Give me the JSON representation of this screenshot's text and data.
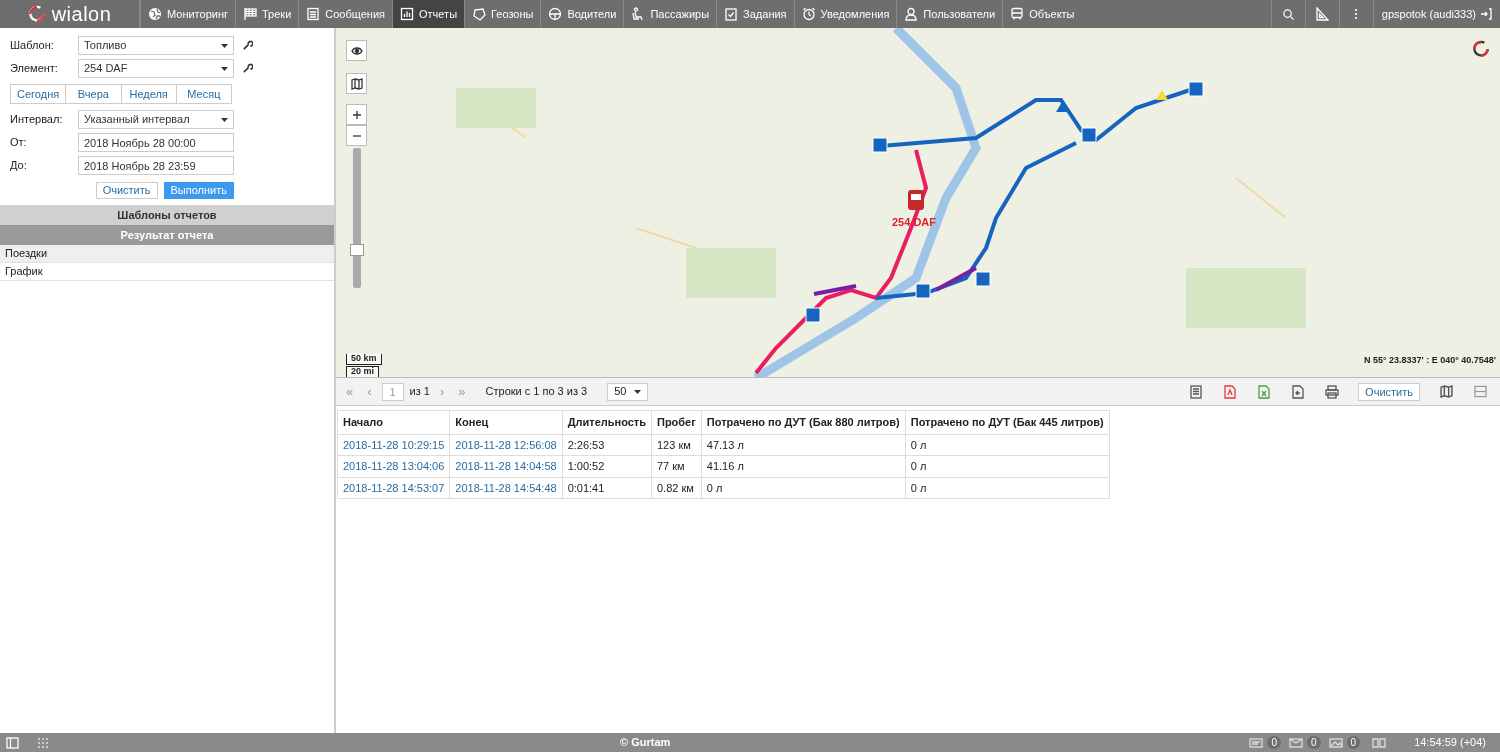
{
  "logo": {
    "text": "wialon"
  },
  "nav": [
    {
      "label": "Мониторинг",
      "selected": false
    },
    {
      "label": "Треки",
      "selected": false
    },
    {
      "label": "Сообщения",
      "selected": false
    },
    {
      "label": "Отчеты",
      "selected": true
    },
    {
      "label": "Геозоны",
      "selected": false
    },
    {
      "label": "Водители",
      "selected": false
    },
    {
      "label": "Пассажиры",
      "selected": false
    },
    {
      "label": "Задания",
      "selected": false
    },
    {
      "label": "Уведомления",
      "selected": false
    },
    {
      "label": "Пользователи",
      "selected": false
    },
    {
      "label": "Объекты",
      "selected": false
    }
  ],
  "user": {
    "name": "gpspotok (audi333)"
  },
  "report_form": {
    "fields": [
      {
        "label": "Шаблон:",
        "value": "Топливо",
        "kind": "select",
        "tool": true
      },
      {
        "label": "Элемент:",
        "value": "254 DAF",
        "kind": "select",
        "tool": true
      },
      {
        "label": "Интервал:",
        "value": "Указанный интервал",
        "kind": "select",
        "tool": false
      },
      {
        "label": "От:",
        "value": "2018 Ноябрь 28 00:00",
        "kind": "input",
        "tool": false
      },
      {
        "label": "До:",
        "value": "2018 Ноябрь 28 23:59",
        "kind": "input",
        "tool": false
      }
    ],
    "presets": [
      "Сегодня",
      "Вчера",
      "Неделя",
      "Месяц"
    ],
    "buttons": [
      {
        "label": "Очистить",
        "primary": false
      },
      {
        "label": "Выполнить",
        "primary": true
      }
    ]
  },
  "sections": [
    {
      "title": "Шаблоны отчетов",
      "selected": false
    },
    {
      "title": "Результат отчета",
      "selected": true
    }
  ],
  "result_items": [
    {
      "label": "Поездки",
      "selected": true
    },
    {
      "label": "График",
      "selected": false
    }
  ],
  "map": {
    "unit_label": "254 DAF",
    "scale": [
      "50 km",
      "20 mi"
    ],
    "coordinates": "N 55° 23.8337' : E 040° 40.7548'",
    "zoom": {
      "level": 0.25
    }
  },
  "pager": {
    "first": "«",
    "prev": "‹",
    "page": "1",
    "of": "из 1",
    "next": "›",
    "last": "»",
    "rows_info": "Строки с 1 по 3 из 3",
    "page_size": "50",
    "clear_button": "Очистить"
  },
  "table": {
    "columns": [
      {
        "label": "Начало",
        "kind": "link"
      },
      {
        "label": "Конец",
        "kind": "link"
      },
      {
        "label": "Длительность",
        "kind": "text"
      },
      {
        "label": "Пробег",
        "kind": "text"
      },
      {
        "label": "Потрачено по ДУТ (Бак 880 литров)",
        "kind": "text"
      },
      {
        "label": "Потрачено по ДУТ (Бак 445 литров)",
        "kind": "text"
      }
    ],
    "rows": [
      [
        "2018-11-28 10:29:15",
        "2018-11-28 12:56:08",
        "2:26:53",
        "123 км",
        "47.13 л",
        "0 л"
      ],
      [
        "2018-11-28 13:04:06",
        "2018-11-28 14:04:58",
        "1:00:52",
        "77 км",
        "41.16 л",
        "0 л"
      ],
      [
        "2018-11-28 14:53:07",
        "2018-11-28 14:54:48",
        "0:01:41",
        "0.82 км",
        "0 л",
        "0 л"
      ]
    ]
  },
  "footer": {
    "copyright": "© Gurtam",
    "counters": [
      "0",
      "0",
      "0"
    ],
    "time": "14:54:59 (+04)"
  }
}
